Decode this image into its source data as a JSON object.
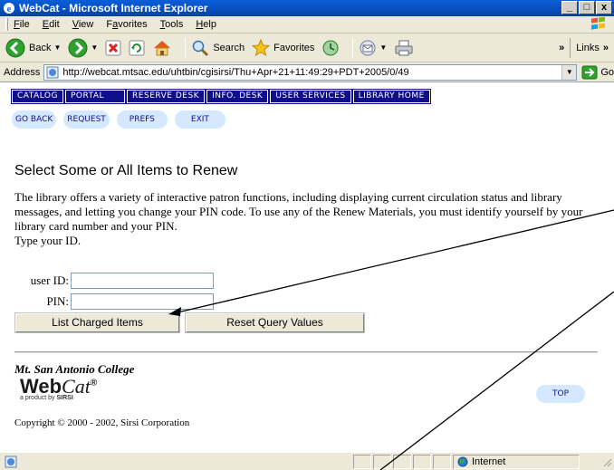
{
  "window": {
    "title": "WebCat - Microsoft Internet Explorer",
    "minimize": "_",
    "maximize": "□",
    "close": "x"
  },
  "menu": {
    "items": [
      {
        "pre": "",
        "u": "F",
        "post": "ile"
      },
      {
        "pre": "",
        "u": "E",
        "post": "dit"
      },
      {
        "pre": "",
        "u": "V",
        "post": "iew"
      },
      {
        "pre": "F",
        "u": "a",
        "post": "vorites"
      },
      {
        "pre": "",
        "u": "T",
        "post": "ools"
      },
      {
        "pre": "",
        "u": "H",
        "post": "elp"
      }
    ]
  },
  "toolbar": {
    "back": "Back",
    "search": "Search",
    "favorites": "Favorites",
    "links": "Links",
    "chevron": "»"
  },
  "address": {
    "label": "Address",
    "url": "http://webcat.mtsac.edu/uhtbin/cgisirsi/Thu+Apr+21+11:49:29+PDT+2005/0/49",
    "go": "Go"
  },
  "nav": {
    "tabs": [
      "CATALOG",
      "PORTAL",
      "RESERVE DESK",
      "INFO. DESK",
      "USER SERVICES",
      "LIBRARY HOME"
    ],
    "pills": [
      "GO BACK",
      "REQUEST",
      "PREFS",
      "EXIT"
    ]
  },
  "page": {
    "title": "Select Some or All Items to Renew",
    "intro": "The library offers a variety of interactive patron functions, including displaying current circulation status and library messages, and letting you change your PIN code. To use any of the Renew Materials, you must identify yourself by your library card number and your PIN.",
    "instruction": "Type your ID.",
    "user_id_label": "user ID:",
    "pin_label": "PIN:",
    "user_id_value": "",
    "pin_value": "",
    "list_button": "List Charged Items",
    "reset_button": "Reset Query Values"
  },
  "footer": {
    "college": "Mt. San Antonio College",
    "logo_web": "Web",
    "logo_cat": "Cat",
    "logo_reg": "®",
    "product_by": "a product by",
    "sirsi": "SIRSI",
    "top": "TOP",
    "copyright": "Copyright © 2000 - 2002, Sirsi Corporation"
  },
  "status": {
    "zone": "Internet"
  },
  "colors": {
    "nav_tab_bg": "#0f0f8a",
    "pill_bg": "#d4e9ff",
    "titlebar": "#0a5fd8"
  }
}
